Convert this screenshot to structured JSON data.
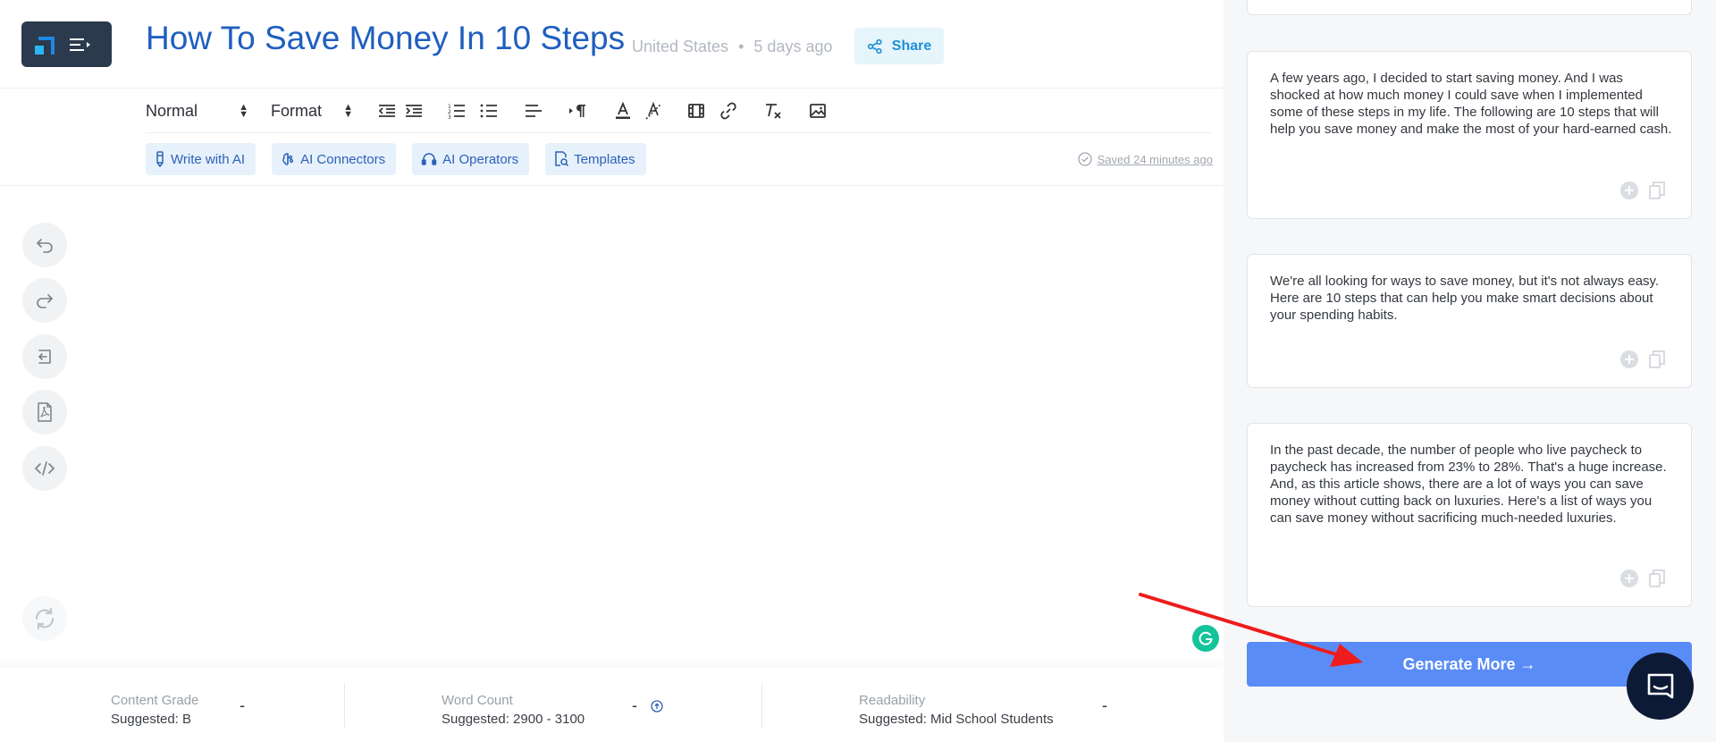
{
  "header": {
    "title": "How To Save Money In 10 Steps",
    "location": "United States",
    "age": "5 days ago",
    "separator": "•",
    "share_label": "Share"
  },
  "toolbar": {
    "style_select": "Normal",
    "format_select": "Format",
    "icons": [
      "outdent-icon",
      "indent-icon",
      "ordered-list-icon",
      "bullet-list-icon",
      "align-icon",
      "text-direction-icon",
      "font-color-icon",
      "highlight-icon",
      "video-icon",
      "link-icon",
      "clear-format-icon",
      "image-icon"
    ]
  },
  "ai_tools": {
    "write_with_ai": "Write with AI",
    "ai_connectors": "AI Connectors",
    "ai_operators": "AI Operators",
    "templates": "Templates"
  },
  "status": {
    "saved": "Saved 24 minutes ago"
  },
  "sidebar": {
    "icons": [
      "undo-icon",
      "redo-icon",
      "import-icon",
      "pdf-icon",
      "code-icon",
      "refresh-icon"
    ]
  },
  "footer": {
    "content_grade": {
      "label": "Content Grade",
      "suggested": "Suggested: B",
      "value": "-"
    },
    "word_count": {
      "label": "Word Count",
      "suggested": "Suggested: 2900 - 3100",
      "value": "-"
    },
    "readability": {
      "label": "Readability",
      "suggested": "Suggested: Mid School Students",
      "value": "-"
    }
  },
  "suggestions": [
    {
      "text": "A few years ago, I decided to start saving money. And I was shocked at how much money I could save when I implemented some of these steps in my life. The following are 10 steps that will help you save money and make the most of your hard-earned cash."
    },
    {
      "text": "We're all looking for ways to save money, but it's not always easy. Here are 10 steps that can help you make smart decisions about your spending habits."
    },
    {
      "text": "In the past decade, the number of people who live paycheck to paycheck has increased from 23% to 28%. That's a huge increase. And, as this article shows, there are a lot of ways you can save money without cutting back on luxuries. Here's a list of ways you can save money without sacrificing much-needed luxuries."
    }
  ],
  "generate_more": "Generate More →",
  "colors": {
    "title_blue": "#1f5fbf",
    "generate_button": "#5a8cf7",
    "chat_button": "#0c1a36",
    "grammarly_green": "#15c39a",
    "annotation_arrow": "#ee1c1c"
  }
}
